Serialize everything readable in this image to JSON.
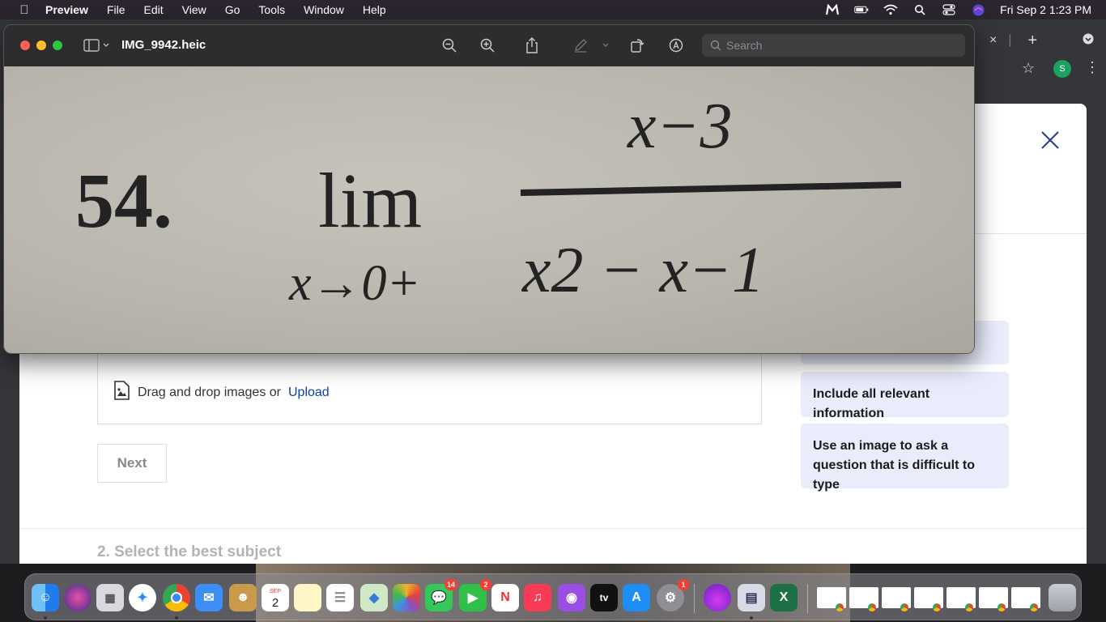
{
  "menubar": {
    "app_name": "Preview",
    "items": [
      "File",
      "Edit",
      "View",
      "Go",
      "Tools",
      "Window",
      "Help"
    ],
    "datetime": "Fri Sep 2  1:23 PM"
  },
  "preview_window": {
    "title": "IMG_9942.heic",
    "search_placeholder": "Search",
    "image_content": {
      "problem_number": "54.",
      "lim_word": "lim",
      "lim_subscript": "x→0+",
      "numerator": "x−3",
      "denominator": "x2 − x−1"
    }
  },
  "page": {
    "upload_text": "Drag and drop images or",
    "upload_link": "Upload",
    "next_label": "Next",
    "tips": [
      "Include all relevant information",
      "Use an image to ask a question that is difficult to type"
    ],
    "section_title": "2. Select the best subject"
  },
  "dock": {
    "calendar_month": "SEP",
    "calendar_day": "2",
    "badges": {
      "messages": "14",
      "facetime": "2",
      "settings": "1"
    },
    "tv_label": "tv"
  },
  "colors": {
    "accent_link": "#0b3fa8",
    "tip_bg": "#e9ecfb"
  }
}
